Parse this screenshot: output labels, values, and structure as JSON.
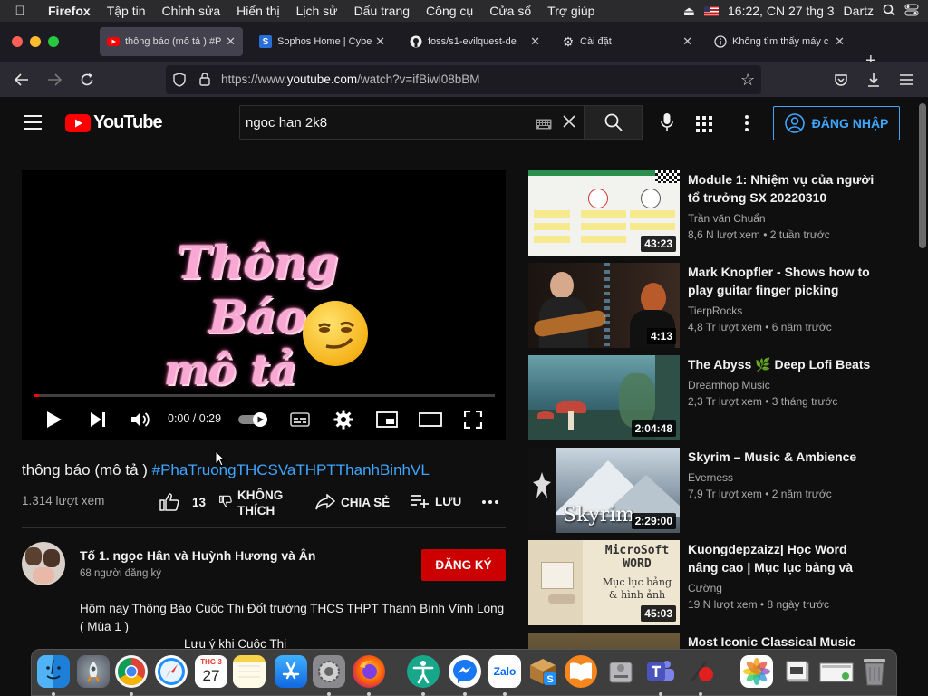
{
  "menubar": {
    "app": "Firefox",
    "items": [
      "Tập tin",
      "Chỉnh sửa",
      "Hiển thị",
      "Lịch sử",
      "Dấu trang",
      "Công cụ",
      "Cửa sổ",
      "Trợ giúp"
    ],
    "clock": "16:22, CN 27 thg 3",
    "user": "Dartz"
  },
  "tabs": [
    {
      "label": "thông báo (mô tả ) #P",
      "icon": "youtube-icon"
    },
    {
      "label": "Sophos Home | Cybe",
      "icon": "sophos-icon"
    },
    {
      "label": "foss/s1-evilquest-de",
      "icon": "github-icon"
    },
    {
      "label": "Cài đặt",
      "icon": "gear-icon"
    },
    {
      "label": "Không tìm thấy máy c",
      "icon": "info-icon"
    }
  ],
  "url": {
    "prefix": "https://www.",
    "domain": "youtube.com",
    "path": "/watch?v=ifBiwl08bBM"
  },
  "youtube": {
    "logo": "YouTube",
    "search_query": "ngoc han 2k8",
    "signin_label": "ĐĂNG NHẬP"
  },
  "player": {
    "overlay_line1": "Thông Báo",
    "overlay_line2": "mô tả",
    "time": "0:00 / 0:29",
    "progress": 0.01
  },
  "video": {
    "title_plain": "thông báo (mô tả ) ",
    "title_tag": "#PhaTruongTHCSVaTHPTThanhBinhVL",
    "views": "1.314 lượt xem",
    "likes": "13",
    "dislike_line1": "KHÔNG",
    "dislike_line2": "THÍCH",
    "share": "CHIA SẺ",
    "save": "LƯU"
  },
  "channel": {
    "name": "Tố 1. ngọc Hân và Huỳnh Hương và Ân",
    "subs": "68 người đăng ký",
    "subscribe": "ĐĂNG KÝ",
    "description": "Hôm nay Thông Báo Cuộc Thi Đốt trường THCS THPT Thanh Bình Vĩnh Long  ( Mùa 1 )",
    "description_more": "Lưu ý khi  Cuộc Thi"
  },
  "recommendations": [
    {
      "title": "Module 1: Nhiệm vụ của người tổ trưởng SX 20220310",
      "channel": "Trần văn Chuẩn",
      "meta": "8,6 N lượt xem • 2 tuần trước",
      "duration": "43:23",
      "thumb_color": "#f2f2ee"
    },
    {
      "title": "Mark Knopfler - Shows how to play guitar finger picking style...",
      "channel": "TierpRocks",
      "meta": "4,8 Tr lượt xem • 6 năm trước",
      "duration": "4:13",
      "thumb_color": "#2a1a14"
    },
    {
      "title": "The Abyss 🌿 Deep Lofi Beats",
      "channel": "Dreamhop Music",
      "meta": "2,3 Tr lượt xem • 3 tháng trước",
      "duration": "2:04:48",
      "thumb_color": "#3d6e7a"
    },
    {
      "title": "Skyrim – Music & Ambience",
      "channel": "Everness",
      "meta": "7,9 Tr lượt xem • 2 năm trước",
      "duration": "2:29:00",
      "thumb_color": "#8a9aa8",
      "thumb_text": "Skyrim"
    },
    {
      "title": "Kuongdepzaizz| Học Word nâng cao | Mục lục bảng và hình ảnh",
      "channel": "Cường",
      "meta": "19 N lượt xem • 8 ngày trước",
      "duration": "45:03",
      "thumb_color": "#efe6d2",
      "thumb_text": "MicroSoft WORD",
      "thumb_text2": "Mục lục bảng & hình ảnh"
    },
    {
      "title": "Most Iconic Classical Music",
      "channel": "",
      "meta": "",
      "duration": "",
      "thumb_color": "#3a3022"
    }
  ],
  "dock": {
    "calendar_month": "THG 3",
    "calendar_day": "27",
    "zalo": "Zalo"
  }
}
